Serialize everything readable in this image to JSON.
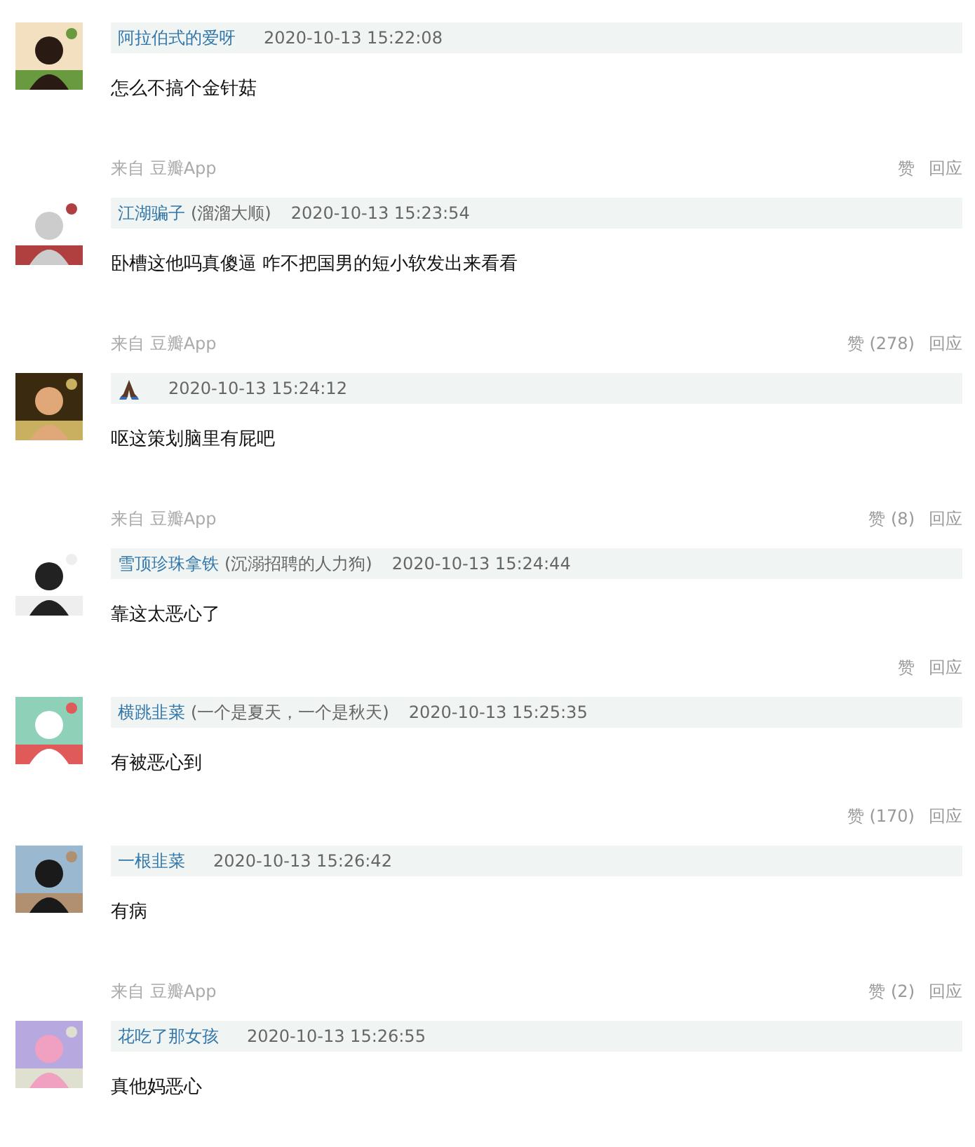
{
  "comments": [
    {
      "user": {
        "kind": "text",
        "name": "阿拉伯式的爱呀"
      },
      "time": "2020-10-13 15:22:08",
      "text": "怎么不搞个金针菇"
    },
    {
      "meta": {
        "source": "来自 豆瓣App",
        "like": "赞",
        "reply": "回应"
      },
      "user": {
        "kind": "text",
        "name": "江湖骗子",
        "nickname": "(溜溜大顺)"
      },
      "time": "2020-10-13 15:23:54",
      "text": "卧槽这他吗真傻逼 咋不把国男的短小软发出来看看"
    },
    {
      "meta": {
        "source": "来自 豆瓣App",
        "like": "赞",
        "like_count": "(278)",
        "reply": "回应"
      },
      "user": {
        "kind": "emoji"
      },
      "time": "2020-10-13 15:24:12",
      "text": "呕这策划脑里有屁吧"
    },
    {
      "meta": {
        "source": "来自 豆瓣App",
        "like": "赞",
        "like_count": "(8)",
        "reply": "回应"
      },
      "user": {
        "kind": "text",
        "name": "雪顶珍珠拿铁",
        "nickname": "(沉溺招聘的人力狗)"
      },
      "time": "2020-10-13 15:24:44",
      "text": "靠这太恶心了"
    },
    {
      "meta": {
        "like": "赞",
        "reply": "回应"
      },
      "user": {
        "kind": "text",
        "name": "横跳韭菜",
        "nickname": "(一个是夏天，一个是秋天)"
      },
      "time": "2020-10-13 15:25:35",
      "text": "有被恶心到"
    },
    {
      "meta": {
        "like": "赞",
        "like_count": "(170)",
        "reply": "回应"
      },
      "user": {
        "kind": "text",
        "name": "一根韭菜"
      },
      "time": "2020-10-13 15:26:42",
      "text": "有病"
    },
    {
      "meta": {
        "source": "来自 豆瓣App",
        "like": "赞",
        "like_count": "(2)",
        "reply": "回应"
      },
      "user": {
        "kind": "text",
        "name": "花吃了那女孩"
      },
      "time": "2020-10-13 15:26:55",
      "text": "真他妈恶心"
    }
  ]
}
